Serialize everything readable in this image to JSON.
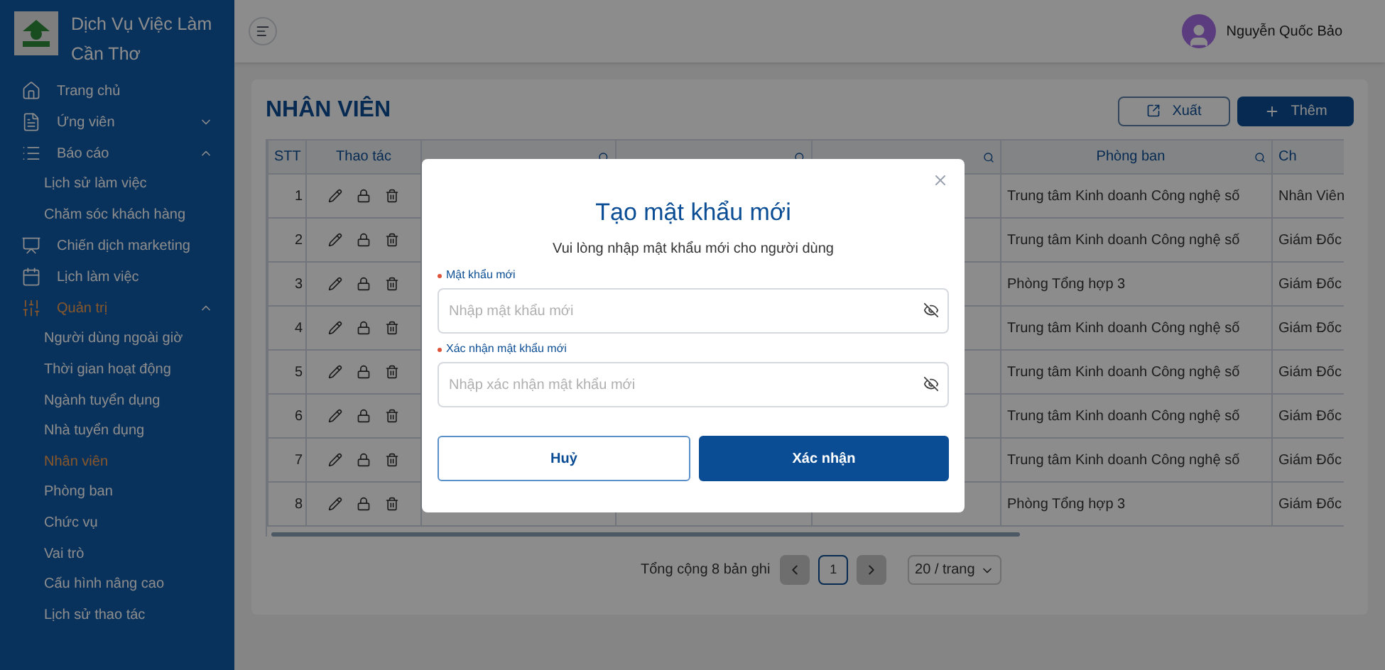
{
  "brand": {
    "title": "Dịch Vụ Việc Làm Cần Thơ"
  },
  "sidebar": {
    "items": [
      {
        "kind": "home",
        "label": "Trang chủ",
        "selected": false
      },
      {
        "kind": "candidate",
        "label": "Ứng viên",
        "selected": false,
        "expanded": false
      },
      {
        "kind": "report",
        "label": "Báo cáo",
        "selected": false,
        "expanded": true,
        "children": [
          {
            "label": "Lịch sử làm việc",
            "selected": false
          },
          {
            "label": "Chăm sóc khách hàng",
            "selected": false
          }
        ]
      },
      {
        "kind": "marketing",
        "label": "Chiến dịch marketing",
        "selected": false
      },
      {
        "kind": "calendar",
        "label": "Lịch làm việc",
        "selected": false
      },
      {
        "kind": "admin",
        "label": "Quản trị",
        "selected": true,
        "expanded": true,
        "children": [
          {
            "label": "Người dùng ngoài giờ",
            "selected": false
          },
          {
            "label": "Thời gian hoạt động",
            "selected": false
          },
          {
            "label": "Ngành tuyển dụng",
            "selected": false
          },
          {
            "label": "Nhà tuyển dụng",
            "selected": false
          },
          {
            "label": "Nhân viên",
            "selected": true
          },
          {
            "label": "Phòng ban",
            "selected": false
          },
          {
            "label": "Chức vụ",
            "selected": false
          },
          {
            "label": "Vai trò",
            "selected": false
          },
          {
            "label": "Cấu hình nâng cao",
            "selected": false
          },
          {
            "label": "Lịch sử thao tác",
            "selected": false
          }
        ]
      }
    ]
  },
  "header": {
    "user_name": "Nguyễn Quốc Bảo"
  },
  "page": {
    "title": "NHÂN VIÊN",
    "buttons": [
      {
        "kind": "export",
        "label": "Xuất"
      },
      {
        "kind": "add",
        "label": "Thêm"
      }
    ]
  },
  "table": {
    "columns": [
      {
        "label": "STT",
        "searchable": false
      },
      {
        "label": "Thao tác",
        "searchable": false
      },
      {
        "searchable": true
      },
      {
        "searchable": true
      },
      {
        "searchable": true
      },
      {
        "label": "Phòng ban",
        "searchable": true
      },
      {
        "label": "Ch"
      }
    ],
    "rows": [
      {
        "stt": "1",
        "department": "Trung tâm Kinh doanh Công nghệ số",
        "position": "Nhân Viên"
      },
      {
        "stt": "2",
        "department": "Trung tâm Kinh doanh Công nghệ số",
        "position": "Giám Đốc"
      },
      {
        "stt": "3",
        "department": "Phòng Tổng hợp 3",
        "position": "Giám Đốc"
      },
      {
        "stt": "4",
        "department": "Trung tâm Kinh doanh Công nghệ số",
        "position": "Giám Đốc"
      },
      {
        "stt": "5",
        "department": "Trung tâm Kinh doanh Công nghệ số",
        "position": "Giám Đốc"
      },
      {
        "stt": "6",
        "department": "Trung tâm Kinh doanh Công nghệ số",
        "position": "Giám Đốc"
      },
      {
        "stt": "7",
        "department": "Trung tâm Kinh doanh Công nghệ số",
        "position": "Giám Đốc"
      },
      {
        "stt": "8",
        "department": "Phòng Tổng hợp 3",
        "position": "Giám Đốc"
      }
    ]
  },
  "pagination": {
    "total": "Tổng cộng 8 bản ghi",
    "pages": [
      {
        "label": "1",
        "selected": true
      }
    ],
    "page_size": "20 / trang"
  },
  "dialog": {
    "title": "Tạo mật khẩu mới",
    "subtitle": "Vui lòng nhập mật khẩu mới cho người dùng",
    "fields": [
      {
        "label": "Mật khẩu mới",
        "required": true,
        "placeholder": "Nhập mật khẩu mới"
      },
      {
        "label": "Xác nhận mật khẩu mới",
        "required": true,
        "placeholder": "Nhập xác nhận mật khẩu mới"
      }
    ],
    "buttons": [
      {
        "kind": "secondary",
        "label": "Huỷ"
      },
      {
        "kind": "primary",
        "label": "Xác nhận"
      }
    ]
  }
}
